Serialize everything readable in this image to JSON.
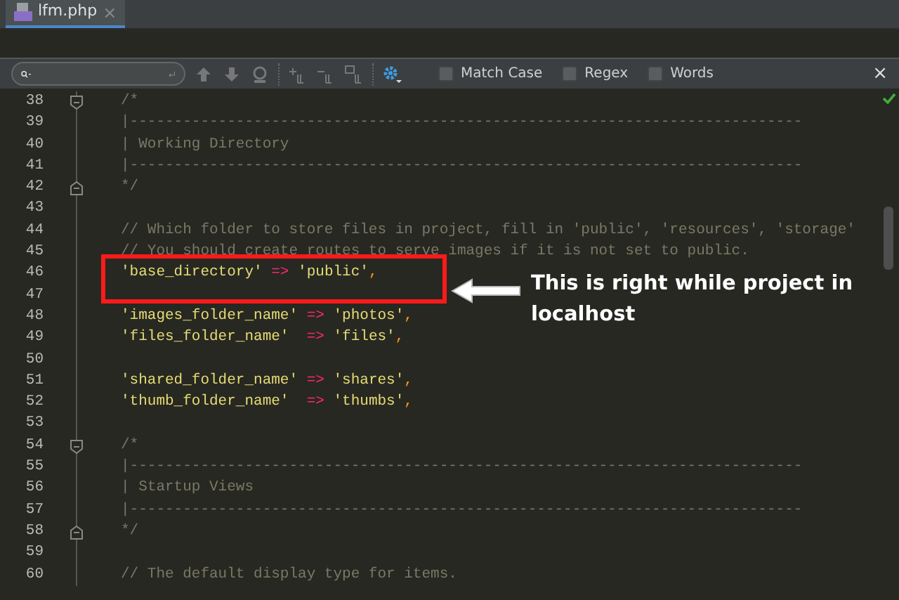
{
  "tabs": [
    {
      "label": "lfm.php",
      "selected": true,
      "close": "×"
    }
  ],
  "search_bar": {
    "options": [
      {
        "label": "Match Case",
        "checked": false
      },
      {
        "label": "Regex",
        "checked": false
      },
      {
        "label": "Words",
        "checked": false
      }
    ],
    "close": "×"
  },
  "editor": {
    "lines": [
      {
        "number": "38",
        "kind": "foldstart",
        "tokens": [
          {
            "kind": "comment",
            "text": "/*"
          }
        ]
      },
      {
        "number": "39",
        "kind": "plain",
        "tokens": [
          {
            "kind": "comment",
            "text": "|----------------------------------------------------------------------------"
          }
        ]
      },
      {
        "number": "40",
        "kind": "plain",
        "tokens": [
          {
            "kind": "comment",
            "text": "| Working Directory"
          }
        ]
      },
      {
        "number": "41",
        "kind": "plain",
        "tokens": [
          {
            "kind": "comment",
            "text": "|----------------------------------------------------------------------------"
          }
        ]
      },
      {
        "number": "42",
        "kind": "foldend",
        "tokens": [
          {
            "kind": "comment",
            "text": "*/"
          }
        ]
      },
      {
        "number": "43",
        "kind": "plain"
      },
      {
        "number": "44",
        "kind": "plain",
        "tokens": [
          {
            "kind": "comment",
            "text": "// Which folder to store files in project, fill in 'public', 'resources', 'storage'"
          }
        ]
      },
      {
        "number": "45",
        "kind": "plain",
        "tokens": [
          {
            "kind": "comment",
            "text": "// You should create routes to serve images if it is not set to public."
          }
        ]
      },
      {
        "number": "46",
        "kind": "plain",
        "tokens": [
          {
            "kind": "string",
            "text": "'base_directory'"
          },
          {
            "kind": "operator",
            "text": " => "
          },
          {
            "kind": "string",
            "text": "'public'"
          },
          {
            "kind": "punct",
            "text": ","
          }
        ]
      },
      {
        "number": "47",
        "kind": "plain"
      },
      {
        "number": "48",
        "kind": "plain",
        "tokens": [
          {
            "kind": "string",
            "text": "'images_folder_name'"
          },
          {
            "kind": "operator",
            "text": " => "
          },
          {
            "kind": "string",
            "text": "'photos'"
          },
          {
            "kind": "punct",
            "text": ","
          }
        ]
      },
      {
        "number": "49",
        "kind": "plain",
        "tokens": [
          {
            "kind": "string",
            "text": "'files_folder_name'"
          },
          {
            "kind": "operator",
            "text": "  => "
          },
          {
            "kind": "string",
            "text": "'files'"
          },
          {
            "kind": "punct",
            "text": ","
          }
        ]
      },
      {
        "number": "50",
        "kind": "plain"
      },
      {
        "number": "51",
        "kind": "plain",
        "tokens": [
          {
            "kind": "string",
            "text": "'shared_folder_name'"
          },
          {
            "kind": "operator",
            "text": " => "
          },
          {
            "kind": "string",
            "text": "'shares'"
          },
          {
            "kind": "punct",
            "text": ","
          }
        ]
      },
      {
        "number": "52",
        "kind": "plain",
        "tokens": [
          {
            "kind": "string",
            "text": "'thumb_folder_name'"
          },
          {
            "kind": "operator",
            "text": "  => "
          },
          {
            "kind": "string",
            "text": "'thumbs'"
          },
          {
            "kind": "punct",
            "text": ","
          }
        ]
      },
      {
        "number": "53",
        "kind": "plain"
      },
      {
        "number": "54",
        "kind": "foldstart",
        "tokens": [
          {
            "kind": "comment",
            "text": "/*"
          }
        ]
      },
      {
        "number": "55",
        "kind": "plain",
        "tokens": [
          {
            "kind": "comment",
            "text": "|----------------------------------------------------------------------------"
          }
        ]
      },
      {
        "number": "56",
        "kind": "plain",
        "tokens": [
          {
            "kind": "comment",
            "text": "| Startup Views"
          }
        ]
      },
      {
        "number": "57",
        "kind": "plain",
        "tokens": [
          {
            "kind": "comment",
            "text": "|----------------------------------------------------------------------------"
          }
        ]
      },
      {
        "number": "58",
        "kind": "foldend",
        "tokens": [
          {
            "kind": "comment",
            "text": "*/"
          }
        ]
      },
      {
        "number": "59",
        "kind": "plain"
      },
      {
        "number": "60",
        "kind": "plain",
        "tokens": [
          {
            "kind": "comment",
            "text": "// The default display type for items."
          }
        ]
      }
    ]
  },
  "annotation": {
    "text": "This is right while project in localhost"
  }
}
